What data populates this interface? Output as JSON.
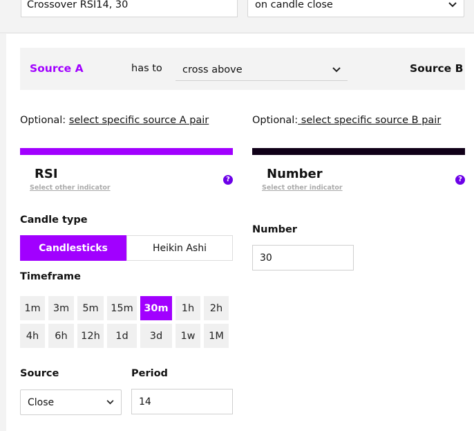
{
  "header": {
    "name_value": "Crossover RSI14, 30",
    "trigger_value": "on candle close"
  },
  "condition": {
    "source_a_label": "Source A",
    "has_to_label": "has to",
    "operator_value": "cross above",
    "source_b_label": "Source B"
  },
  "source_a": {
    "optional_prefix": "Optional:",
    "optional_link": "select specific source A pair",
    "indicator_name": "RSI",
    "select_other": "Select other indicator",
    "help_glyph": "?",
    "candle_type_label": "Candle type",
    "candle_types": [
      "Candlesticks",
      "Heikin Ashi"
    ],
    "timeframe_label": "Timeframe",
    "timeframes_row1": [
      "1m",
      "3m",
      "5m",
      "15m",
      "30m",
      "1h",
      "2h"
    ],
    "timeframes_row2": [
      "4h",
      "6h",
      "12h",
      "1d",
      "3d",
      "1w",
      "1M"
    ],
    "active_timeframe": "30m",
    "source_label": "Source",
    "source_value": "Close",
    "period_label": "Period",
    "period_value": "14"
  },
  "source_b": {
    "optional_prefix": "Optional:",
    "optional_link": " select specific source B pair",
    "indicator_name": "Number",
    "select_other": "Select other indicator",
    "help_glyph": "?",
    "number_label": "Number",
    "number_value": "30"
  },
  "colors": {
    "accent": "#a100ff",
    "dark_bar": "#100018",
    "help_icon": "#6c00e8"
  }
}
